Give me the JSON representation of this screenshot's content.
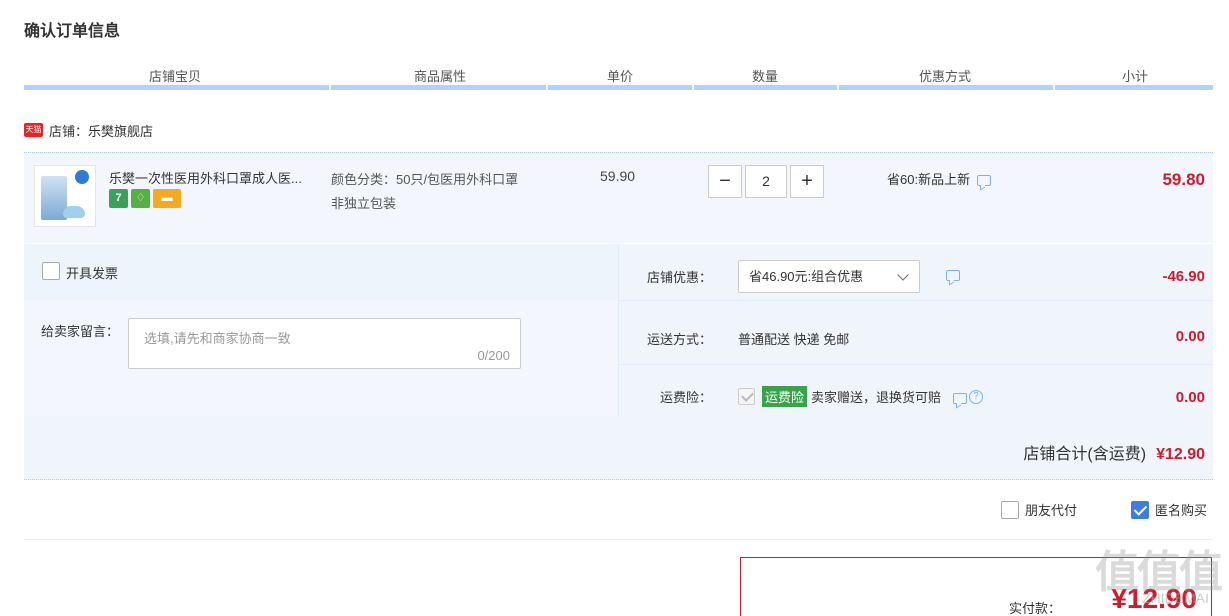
{
  "page_title": "确认订单信息",
  "columns": [
    "店铺宝贝",
    "商品属性",
    "单价",
    "数量",
    "优惠方式",
    "小计"
  ],
  "shop": {
    "badge": "天猫",
    "label": "店铺：乐樊旗舰店"
  },
  "item": {
    "title": "乐樊一次性医用外科口罩成人医...",
    "attr_line1": "颜色分类：50只/包医用外科口罩",
    "attr_line2": "非独立包装",
    "unit_price": "59.90",
    "quantity": "2",
    "minus": "−",
    "plus": "+",
    "promo": "省60:新品上新",
    "subtotal": "59.80"
  },
  "invoice_label": "开具发票",
  "message": {
    "label": "给卖家留言：",
    "placeholder": "选填,请先和商家协商一致",
    "count": "0/200"
  },
  "shop_discount": {
    "label": "店铺优惠：",
    "selected": "省46.90元:组合优惠",
    "amount": "-46.90"
  },
  "shipping": {
    "label": "运送方式：",
    "value": "普通配送 快递 免邮",
    "amount": "0.00"
  },
  "insurance": {
    "label": "运费险：",
    "tag": "运费险",
    "desc": "卖家赠送，退换货可赔",
    "help": "?",
    "amount": "0.00"
  },
  "shop_total": {
    "label": "店铺合计(含运费)",
    "amount": "¥12.90"
  },
  "options": {
    "friend_pay": "朋友代付",
    "anonymous": "匿名购买"
  },
  "payment": {
    "label": "实付款：",
    "amount": "¥12.90"
  },
  "watermark": {
    "text": "值值值",
    "sub": "ZHIDEMAI"
  },
  "colors": {
    "price_red": "#d11a2d",
    "accent_blue": "#3d7ee0",
    "panel_bg": "#f3f7fd",
    "insurance_green": "#38a449"
  }
}
